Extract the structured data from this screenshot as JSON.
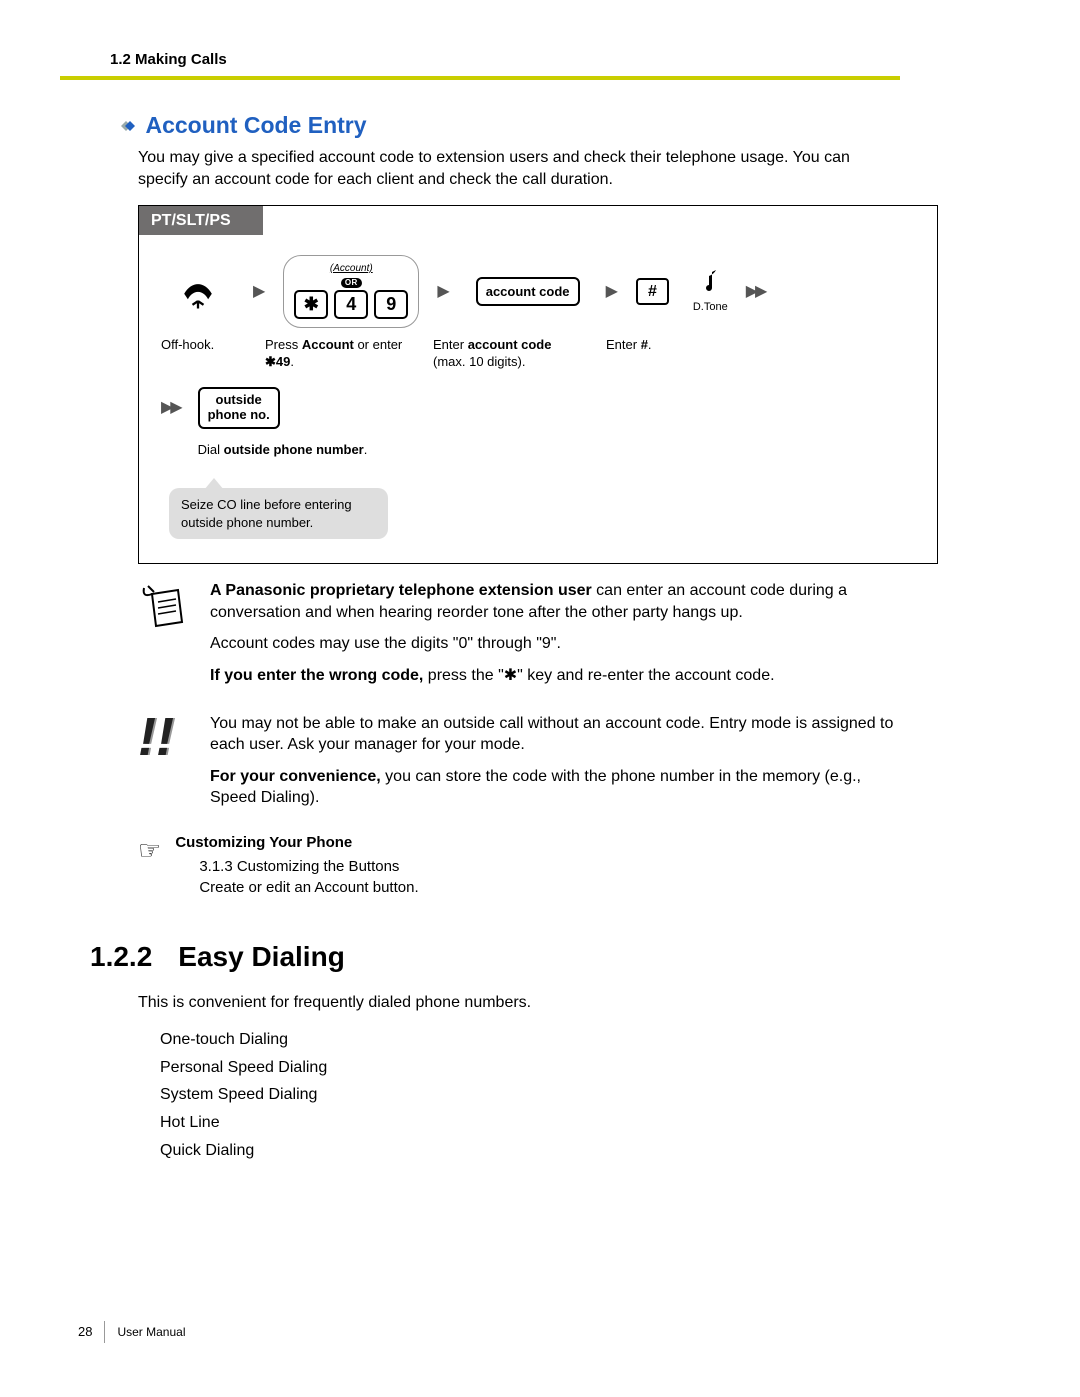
{
  "header": {
    "breadcrumb": "1.2 Making Calls"
  },
  "section1": {
    "title": "Account Code Entry",
    "intro": "You may give a specified account code to extension users and check their telephone usage. You can specify an account code for each client and check the call duration."
  },
  "diagram": {
    "tab": "PT/SLT/PS",
    "account_label": "(Account)",
    "or_label": "OR",
    "keys": [
      "✱",
      "4",
      "9"
    ],
    "account_code_box": "account code",
    "hash_key": "#",
    "dtone": "D.Tone",
    "outside_box_line1": "outside",
    "outside_box_line2": "phone no.",
    "cap_offhook": "Off-hook.",
    "cap_press_1": "Press ",
    "cap_press_2": "Account",
    "cap_press_3": " or enter ",
    "cap_press_4": "✱49",
    "cap_press_5": ".",
    "cap_enter_1": "Enter ",
    "cap_enter_2": "account code",
    "cap_enter_3": " (max. 10 digits).",
    "cap_hash_1": "Enter ",
    "cap_hash_2": "#",
    "cap_hash_3": ".",
    "cap_dial_1": "Dial ",
    "cap_dial_2": "outside phone number",
    "cap_dial_3": ".",
    "cloud_note": "Seize CO line before entering outside phone number."
  },
  "notes": {
    "n1_a": "A Panasonic proprietary telephone extension user",
    "n1_b": " can enter an account code during a conversation and when hearing reorder tone after the other party hangs up.",
    "n2": "Account codes may use the digits \"0\" through \"9\".",
    "n3_a": "If you enter the wrong code,",
    "n3_b": " press the \"✱\" key and re-enter the account code.",
    "w1": "You may not be able to make an outside call without an account code. Entry mode is assigned to each user. Ask your manager for your mode.",
    "w2_a": "For your convenience,",
    "w2_b": " you can store the code with the phone number in the memory (e.g., Speed Dialing)."
  },
  "ref": {
    "heading": "Customizing Your Phone",
    "line1": "3.1.3 Customizing the Buttons",
    "line2": "Create or edit an Account button."
  },
  "section2": {
    "number": "1.2.2",
    "title": "Easy Dialing",
    "intro": "This is convenient for frequently dialed phone numbers.",
    "items": [
      "One-touch Dialing",
      "Personal Speed Dialing",
      "System Speed Dialing",
      "Hot Line",
      "Quick Dialing"
    ]
  },
  "footer": {
    "page": "28",
    "label": "User Manual"
  }
}
